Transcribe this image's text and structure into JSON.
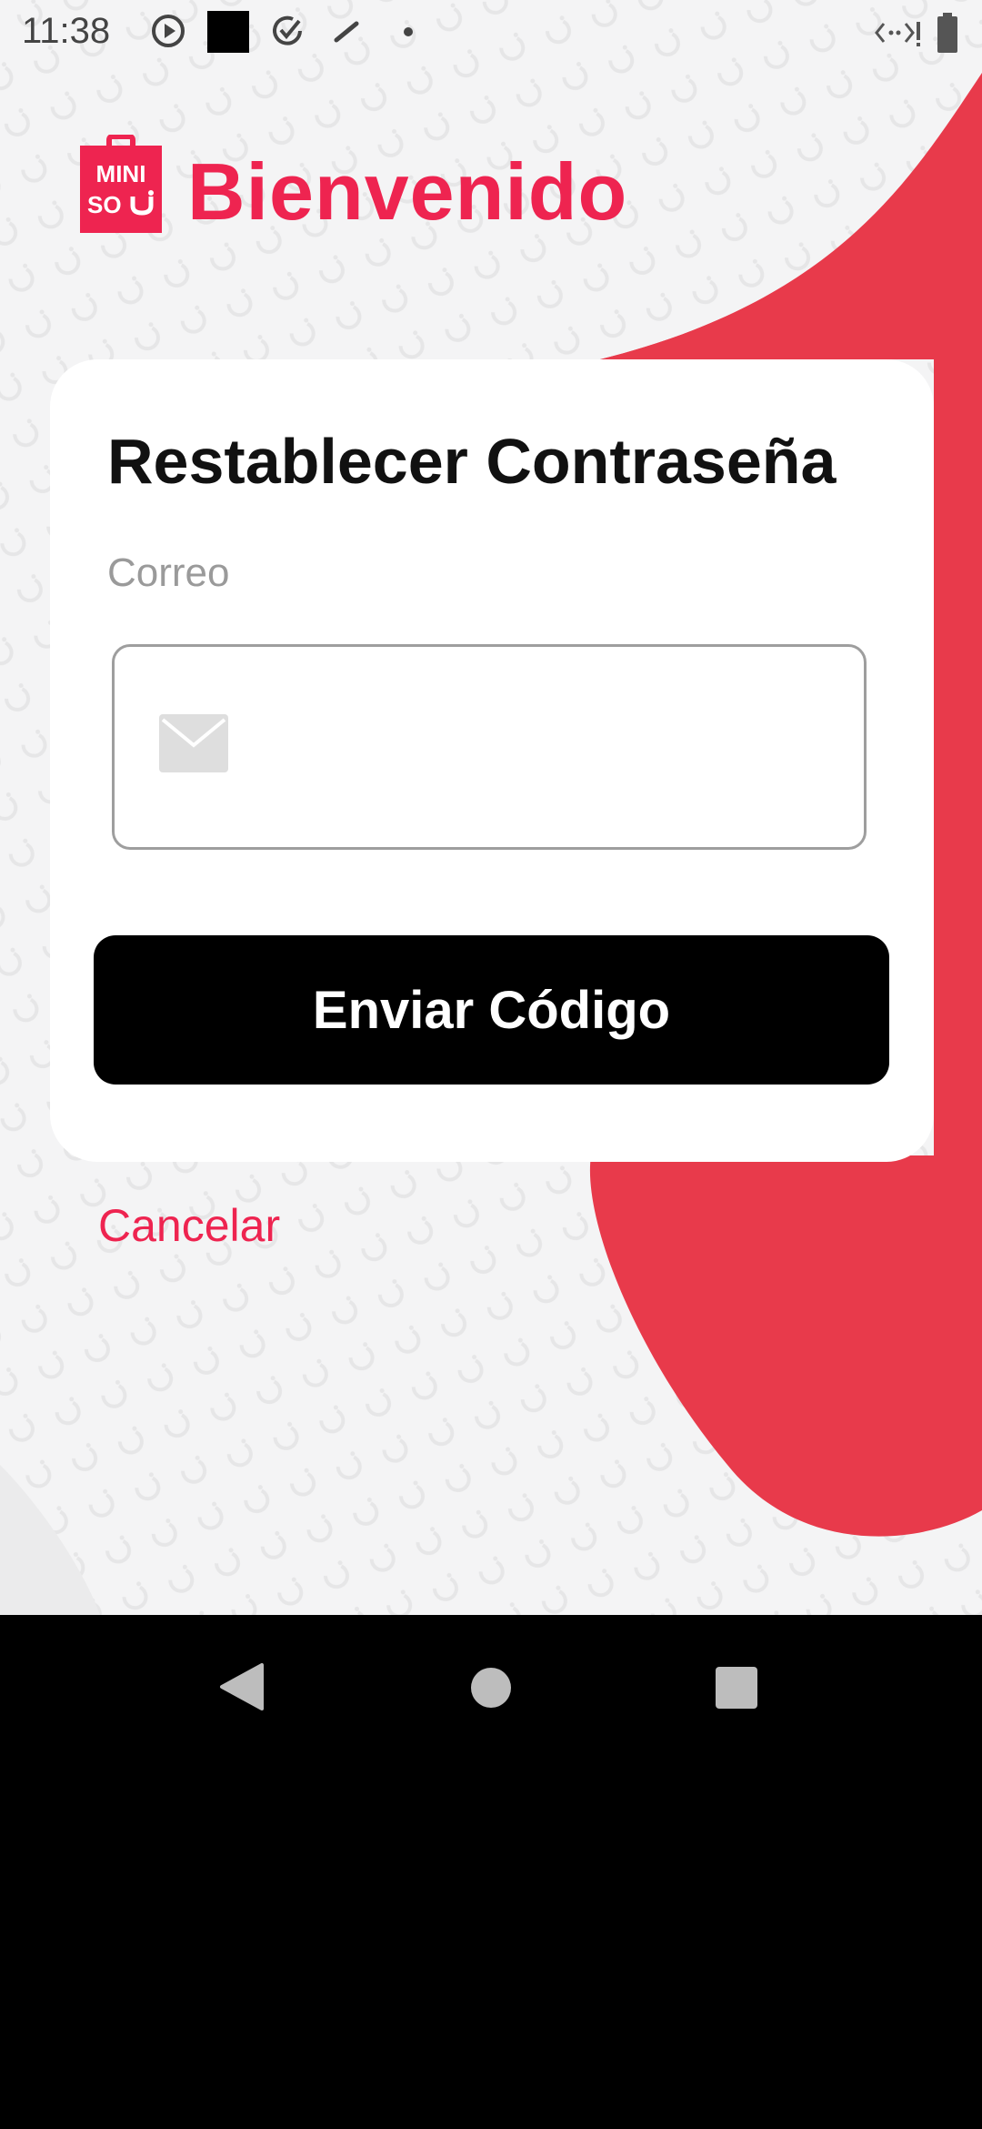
{
  "status_bar": {
    "time": "11:38",
    "icons": [
      "play-circle-icon",
      "square-icon",
      "check-circle-icon",
      "feather-icon",
      "dot-icon",
      "signal-icon",
      "battery-icon"
    ]
  },
  "header": {
    "logo_text_line1": "MINI",
    "logo_text_line2": "SO",
    "title": "Bienvenido"
  },
  "card": {
    "title": "Restablecer Contraseña",
    "email_label": "Correo",
    "email_value": "",
    "email_placeholder": "",
    "send_button": "Enviar Código"
  },
  "cancel_link": "Cancelar",
  "nav_bar": {
    "icons": [
      "back-icon",
      "home-icon",
      "recents-icon"
    ]
  },
  "colors": {
    "brand": "#ee2450",
    "blob": "#e83a4b",
    "background": "#f4f4f5",
    "button": "#000000"
  }
}
